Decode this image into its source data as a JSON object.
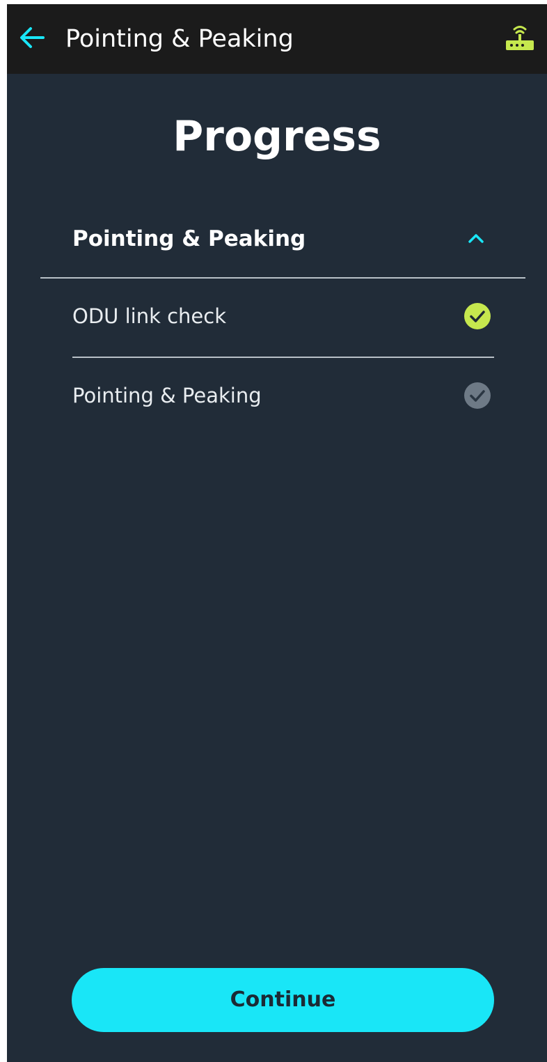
{
  "app_bar": {
    "title": "Pointing & Peaking",
    "back_icon": "arrow-left-icon",
    "status_icon": "router-wifi-icon",
    "accent_color": "#19e6f7",
    "status_color": "#c6e84e",
    "background": "#1b1b1b"
  },
  "page": {
    "title": "Progress",
    "background": "#212c38"
  },
  "section": {
    "title": "Pointing & Peaking",
    "expanded": true,
    "toggle_icon": "chevron-up-icon",
    "steps": [
      {
        "label": "ODU link check",
        "status": "complete",
        "icon": "check-circle-icon",
        "icon_color": "#c6e84e"
      },
      {
        "label": "Pointing & Peaking",
        "status": "pending",
        "icon": "check-circle-icon",
        "icon_color": "#6e7a86"
      }
    ]
  },
  "footer": {
    "continue_label": "Continue",
    "button_color": "#19e6f7"
  }
}
